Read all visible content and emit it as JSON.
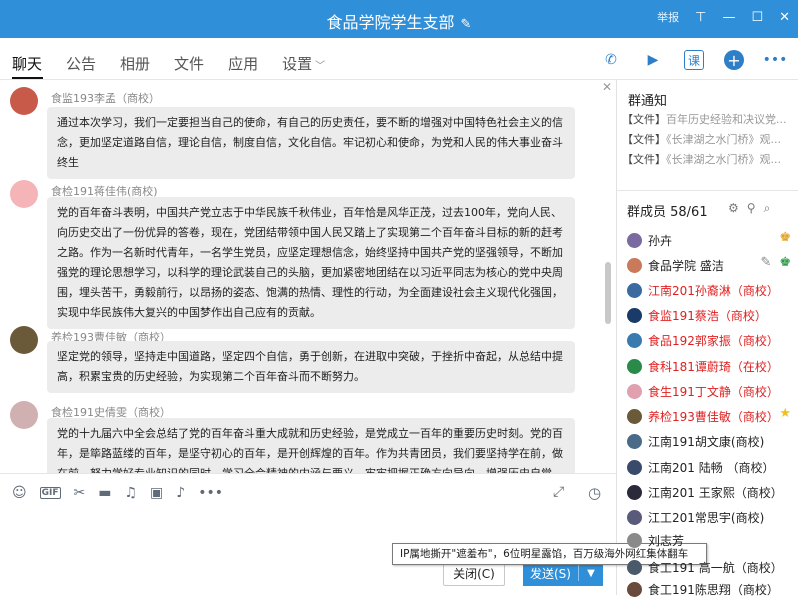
{
  "window": {
    "title": "食品学院学生支部",
    "report_label": "举报",
    "edit_icon": "pencil-icon",
    "controls": [
      "pin-icon",
      "minimize-icon",
      "maximize-icon",
      "close-icon"
    ]
  },
  "tabs": [
    {
      "label": "聊天",
      "active": true
    },
    {
      "label": "公告"
    },
    {
      "label": "相册"
    },
    {
      "label": "文件"
    },
    {
      "label": "应用"
    },
    {
      "label": "设置",
      "has_dropdown": true
    }
  ],
  "toolbar": {
    "icons": [
      "phone-icon",
      "video-icon",
      "class-icon",
      "add-icon",
      "more-icon"
    ],
    "class_label": "课"
  },
  "chat": {
    "messages": [
      {
        "sender": "食监193李孟（商校）",
        "avatar_color": "#c85a4a",
        "text": "通过本次学习，我们一定要担当自己的使命，有自己的历史责任，要不断的增强对中国特色社会主义的信念，更加坚定道路自信，理论自信，制度自信，文化自信。牢记初心和使命，为党和人民的伟大事业奋斗终生"
      },
      {
        "sender": "食检191蒋佳伟(商校)",
        "avatar_color": "#f4b4b8",
        "text": "党的百年奋斗表明，中国共产党立志于中华民族千秋伟业，百年恰是风华正茂，过去100年，党向人民、向历史交出了一份优异的答卷，现在，党团结带领中国人民又踏上了实现第二个百年奋斗目标的新的赶考之路。作为一名新时代青年，一名学生党员，应坚定理想信念，始终坚持中国共产党的坚强领导，不断加强党的理论思想学习，以科学的理论武装自己的头脑，更加紧密地团结在以习近平同志为核心的党中央周围，埋头苦干，勇毅前行，以昂扬的姿态、饱满的热情、理性的行动，为全面建设社会主义现代化强国，实现中华民族伟大复兴的中国梦作出自己应有的贡献。"
      },
      {
        "sender": "养检193曹佳敏（商校）",
        "avatar_color": "#6a5a3a",
        "text": "坚定党的领导，坚持走中国道路，坚定四个自信，勇于创新，在进取中突破，于挫折中奋起，从总结中提高，积累宝贵的历史经验，为实现第二个百年奋斗而不断努力。"
      },
      {
        "sender": "食检191史倩雯（商校）",
        "avatar_color": "#d0b0b0",
        "text": "党的十九届六中全会总结了党的百年奋斗重大成就和历史经验，是党成立一百年的重要历史时刻。党的百年，是筚路蓝缕的百年，是坚守初心的百年，是开创辉煌的百年。作为共青团员，我们要坚持学在前，做在前，努力学好专业知识的同时，学习全会精神的内涵与要义，牢牢把握正确方向导向，增强历史自觉。作为"
      }
    ]
  },
  "input": {
    "icons": [
      "emoji-icon",
      "gif-icon",
      "scissors-icon",
      "folder-icon",
      "music-icon",
      "image-icon",
      "bell-icon",
      "more-icon",
      "expand-icon",
      "history-icon"
    ],
    "gif_label": "GIF",
    "close_label": "关闭(C)",
    "send_label": "发送(S)"
  },
  "tooltip": "IP属地撕开\"遮羞布\"，6位明星露馅，百万级海外网红集体翻车",
  "notice": {
    "title": "群通知",
    "items": [
      {
        "tag": "【文件】",
        "text": "百年历史经验和决议党..."
      },
      {
        "tag": "【文件】",
        "text": "《长津湖之水门桥》观..."
      },
      {
        "tag": "【文件】",
        "text": "《长津湖之水门桥》观..."
      }
    ]
  },
  "members": {
    "title": "群成员 58/61",
    "header_icons": [
      "group-settings-icon",
      "add-member-icon",
      "search-icon"
    ],
    "list": [
      {
        "name": "孙卉",
        "color": "#7a6aa0",
        "red": false,
        "badge": "owner-icon"
      },
      {
        "name": "食品学院 盛洁",
        "color": "#c87a5a",
        "red": false,
        "badge": "admin-icon",
        "edit": true
      },
      {
        "name": "江南201孙裔淋（商校）",
        "color": "#3a6aa0",
        "red": true
      },
      {
        "name": "食监191蔡浩（商校）",
        "color": "#1a3a6a",
        "red": true
      },
      {
        "name": "食品192郭家振（商校）",
        "color": "#3a7ab0",
        "red": true
      },
      {
        "name": "食科181谭蔚琦（在校）",
        "color": "#2a8a4a",
        "red": true
      },
      {
        "name": "食生191丁文静（商校）",
        "color": "#e0a0b0",
        "red": true
      },
      {
        "name": "养检193曹佳敏（商校）",
        "color": "#6a5a3a",
        "red": true,
        "badge": "star-icon"
      },
      {
        "name": "江南191胡文康(商校)",
        "color": "#4a6a8a",
        "red": false
      },
      {
        "name": "江南201 陆畅 （商校）",
        "color": "#3a4a6a",
        "red": false
      },
      {
        "name": "江南201 王家熙（商校）",
        "color": "#2a2a3a",
        "red": false
      },
      {
        "name": "江工201常思宇(商校)",
        "color": "#5a5a7a",
        "red": false
      },
      {
        "name": "刘志芳",
        "color": "#8a8a8a",
        "red": false
      },
      {
        "name": "食工191 高一航（商校）",
        "color": "#4a5a6a",
        "red": false
      },
      {
        "name": "食工191陈思翔（商校）",
        "color": "#6a4a3a",
        "red": false
      }
    ]
  }
}
